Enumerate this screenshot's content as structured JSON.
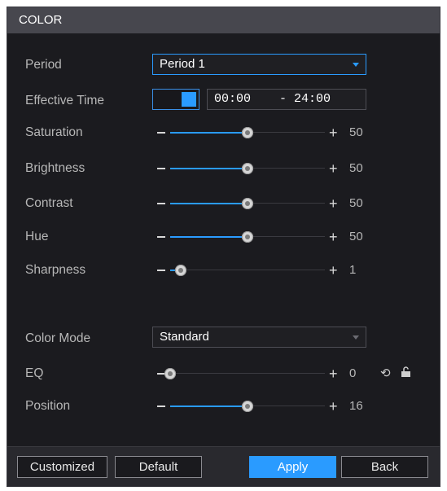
{
  "window": {
    "title": "COLOR"
  },
  "rows": {
    "period": {
      "label": "Period",
      "value": "Period 1"
    },
    "effective_time": {
      "label": "Effective Time",
      "start": "00:00",
      "end": "- 24:00",
      "enabled": true
    },
    "saturation": {
      "label": "Saturation",
      "value": "50",
      "level": 0.5
    },
    "brightness": {
      "label": "Brightness",
      "value": "50",
      "level": 0.5
    },
    "contrast": {
      "label": "Contrast",
      "value": "50",
      "level": 0.5
    },
    "hue": {
      "label": "Hue",
      "value": "50",
      "level": 0.5
    },
    "sharpness": {
      "label": "Sharpness",
      "value": "1",
      "level": 0.07
    },
    "color_mode": {
      "label": "Color Mode",
      "value": "Standard"
    },
    "eq": {
      "label": "EQ",
      "value": "0",
      "level": 0.0
    },
    "position": {
      "label": "Position",
      "value": "16",
      "level": 0.5
    }
  },
  "icons": {
    "minus": "minus-icon",
    "plus": "plus-icon",
    "reset": "reset-icon",
    "lock": "lock-icon",
    "dropdown": "chevron-down-icon"
  },
  "buttons": {
    "customized": "Customized",
    "default": "Default",
    "apply": "Apply",
    "back": "Back"
  },
  "colors": {
    "accent": "#2a9bff",
    "panel": "#1b1b1f",
    "titlebar": "#47474e"
  }
}
